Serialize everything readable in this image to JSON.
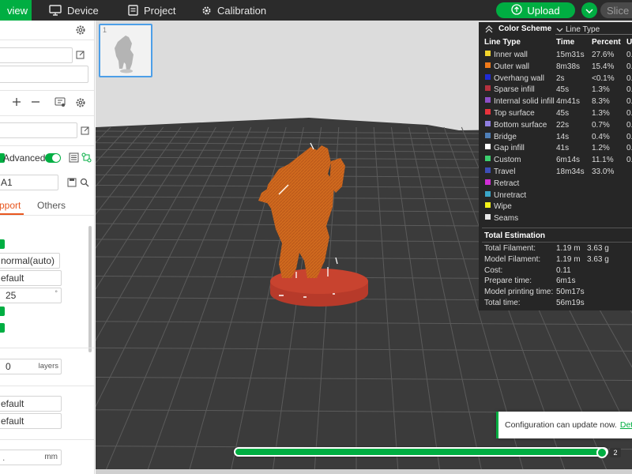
{
  "topbar": {
    "preview_tab": "view",
    "nav": [
      {
        "label": "Device",
        "icon": "monitor-icon"
      },
      {
        "label": "Project",
        "icon": "document-icon"
      },
      {
        "label": "Calibration",
        "icon": "calibration-gear-icon"
      }
    ],
    "upload_label": "Upload",
    "slice_label": "Slice p"
  },
  "left_panel": {
    "advanced_label": "Advanced",
    "advanced_enabled": true,
    "preset_value": "A1",
    "tabs": [
      {
        "label": "pport",
        "active": true
      },
      {
        "label": "Others",
        "active": false
      }
    ],
    "support_type": "normal(auto)",
    "style_value": "efault",
    "threshold_value": "25",
    "threshold_unit": "°",
    "layers_value": "0",
    "layers_unit": "layers",
    "value_a": "efault",
    "value_b": "efault",
    "mm_value": ".",
    "mm_unit": "mm"
  },
  "viewport": {
    "plate_number": "1"
  },
  "legend": {
    "title": "Color Scheme",
    "mode": "Line Type",
    "columns": {
      "line_type": "Line Type",
      "time": "Time",
      "percent": "Percent",
      "usage": "U"
    },
    "rows": [
      {
        "name": "Inner wall",
        "color": "#f2d42c",
        "time": "15m31s",
        "percent": "27.6%",
        "usage": "0."
      },
      {
        "name": "Outer wall",
        "color": "#f07a1a",
        "time": "8m38s",
        "percent": "15.4%",
        "usage": "0."
      },
      {
        "name": "Overhang wall",
        "color": "#1f2bd6",
        "time": "2s",
        "percent": "<0.1%",
        "usage": "0."
      },
      {
        "name": "Sparse infill",
        "color": "#b5323f",
        "time": "45s",
        "percent": "1.3%",
        "usage": "0."
      },
      {
        "name": "Internal solid infill",
        "color": "#8d4fc7",
        "time": "4m41s",
        "percent": "8.3%",
        "usage": "0."
      },
      {
        "name": "Top surface",
        "color": "#e8333c",
        "time": "45s",
        "percent": "1.3%",
        "usage": "0."
      },
      {
        "name": "Bottom surface",
        "color": "#8f7ee0",
        "time": "22s",
        "percent": "0.7%",
        "usage": "0."
      },
      {
        "name": "Bridge",
        "color": "#4f7fb8",
        "time": "14s",
        "percent": "0.4%",
        "usage": "0."
      },
      {
        "name": "Gap infill",
        "color": "#ffffff",
        "time": "41s",
        "percent": "1.2%",
        "usage": "0."
      },
      {
        "name": "Custom",
        "color": "#3ccf6e",
        "time": "6m14s",
        "percent": "11.1%",
        "usage": "0."
      },
      {
        "name": "Travel",
        "color": "#3d4fb8",
        "time": "18m34s",
        "percent": "33.0%",
        "usage": ""
      },
      {
        "name": "Retract",
        "color": "#d12ed6",
        "time": "",
        "percent": "",
        "usage": ""
      },
      {
        "name": "Unretract",
        "color": "#3aa6c9",
        "time": "",
        "percent": "",
        "usage": ""
      },
      {
        "name": "Wipe",
        "color": "#f4f21a",
        "time": "",
        "percent": "",
        "usage": ""
      },
      {
        "name": "Seams",
        "color": "#e8e8e8",
        "time": "",
        "percent": "",
        "usage": ""
      }
    ],
    "estimation_title": "Total Estimation",
    "estimation": [
      {
        "label": "Total Filament:",
        "value": "1.19 m",
        "extra": "3.63 g"
      },
      {
        "label": "Model Filament:",
        "value": "1.19 m",
        "extra": "3.63 g"
      },
      {
        "label": "Cost:",
        "value": "0.11",
        "extra": ""
      },
      {
        "label": "Prepare time:",
        "value": "6m1s",
        "extra": ""
      },
      {
        "label": "Model printing time:",
        "value": "50m17s",
        "extra": ""
      },
      {
        "label": "Total time:",
        "value": "56m19s",
        "extra": ""
      }
    ]
  },
  "notification": {
    "message": "Configuration can update now.",
    "link": "Detail"
  },
  "layer_slider": {
    "label": "2",
    "fraction": 1.0
  },
  "colors": {
    "accent": "#00ae42",
    "plate": "#3a3a3a",
    "model": "#d06a1e",
    "legend_bg": "#262626"
  }
}
